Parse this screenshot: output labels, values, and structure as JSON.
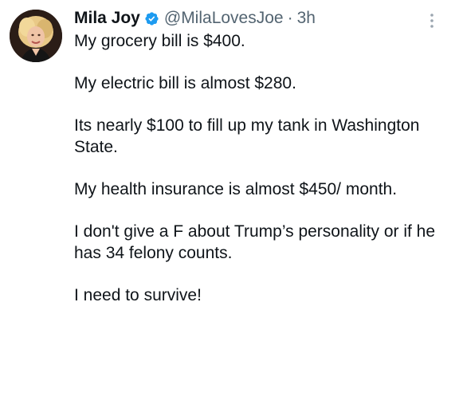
{
  "tweet": {
    "author": {
      "display_name": "Mila Joy",
      "verified_icon": "verified-badge-icon",
      "handle": "@MilaLovesJoe",
      "separator": "·",
      "time": "3h"
    },
    "more_icon": "more-options-icon",
    "paragraphs": [
      "My grocery bill is $400.",
      "My electric bill is almost $280.",
      "Its nearly $100 to fill up my tank in Washington State.",
      "My health insurance is almost $450/ month.",
      "I don't give a F about Trump’s personality or if he has 34 felony counts.",
      "I need to survive!"
    ]
  },
  "colors": {
    "text": "#0f1419",
    "secondary_text": "#536471",
    "verified_blue": "#1d9bf0"
  }
}
